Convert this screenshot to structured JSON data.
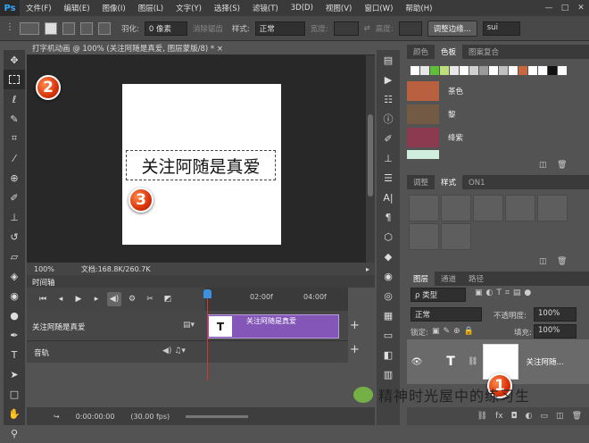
{
  "menubar": {
    "logo": "Ps",
    "items": [
      "文件(F)",
      "编辑(E)",
      "图像(I)",
      "图层(L)",
      "文字(Y)",
      "选择(S)",
      "滤镜(T)",
      "3D(D)",
      "视图(V)",
      "窗口(W)",
      "帮助(H)"
    ],
    "window_controls": [
      "—",
      "□",
      "✕"
    ]
  },
  "options": {
    "feather_label": "羽化:",
    "feather_value": "0 像素",
    "antialias_label": "消除锯齿",
    "style_label": "样式:",
    "style_value": "正常",
    "width_label": "宽度:",
    "height_label": "高度:",
    "refine_edge": "调整边缘...",
    "workspace_value": "sui"
  },
  "document": {
    "tab_title": "打字机动画 @ 100% (关注阿随是真爱, 图层蒙版/8) * ×",
    "canvas_text": "关注阿随是真爱",
    "zoom": "100%",
    "doc_info": "文档:168.8K/260.7K"
  },
  "timeline": {
    "title": "时间轴",
    "ruler_marks": [
      "02:00f",
      "04:00f"
    ],
    "track_name": "关注阿随是真爱",
    "clip_label": "关注阿随是真爱",
    "clip_icon": "T",
    "audio_label": "音轨",
    "timecode": "0:00:00:00",
    "fps": "(30.00 fps)"
  },
  "panels": {
    "swatch_tabs": [
      "颜色",
      "色板",
      "图案复合"
    ],
    "swatch_strip": [
      "#ffffff",
      "#e8e8e8",
      "#5fbf3a",
      "#bde07a",
      "#e8e8e8",
      "#ffffff",
      "#d0d0d0",
      "#9a9a9a",
      "#ffffff",
      "#c0c0c0",
      "#ffffff",
      "#c9673f",
      "#ffffff",
      "#ffffff",
      "#111111",
      "#ffffff"
    ],
    "swatches": [
      {
        "name": "茶色",
        "color": "#b8603f"
      },
      {
        "name": "黎",
        "color": "#735a45"
      },
      {
        "name": "绛紫",
        "color": "#8c3a50"
      }
    ],
    "style_tabs": [
      "调整",
      "样式",
      "ON1"
    ],
    "layer_tabs": [
      "图层",
      "通道",
      "路径"
    ],
    "filter_label": "ρ 类型",
    "blend_mode": "正常",
    "opacity_label": "不透明度:",
    "opacity_value": "100%",
    "lock_label": "锁定:",
    "fill_label": "填充:",
    "fill_value": "100%",
    "layer_name": "关注阿随...",
    "layer_type_icon": "T"
  },
  "callouts": [
    "1",
    "2",
    "3"
  ],
  "watermark": "精神时光屋中的练习生"
}
